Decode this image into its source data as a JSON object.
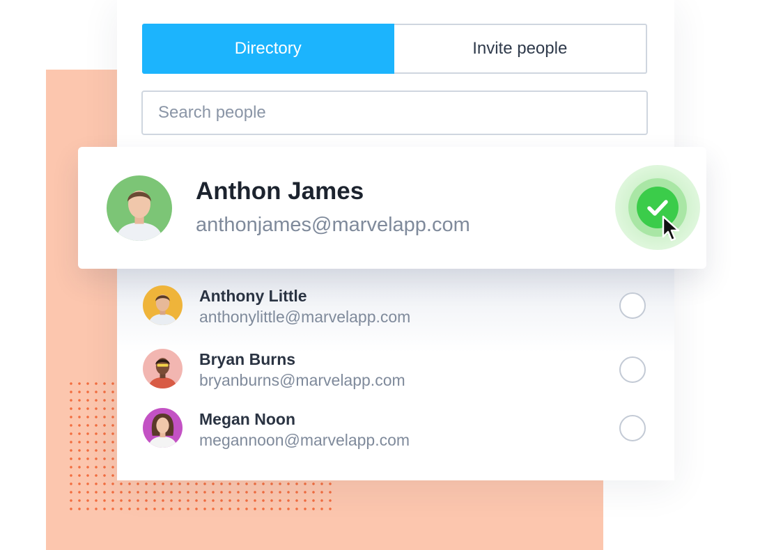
{
  "tabs": {
    "directory_label": "Directory",
    "invite_label": "Invite people",
    "active": "Directory"
  },
  "search": {
    "placeholder": "Search people",
    "value": ""
  },
  "selected_person": {
    "name": "Anthon James",
    "email": "anthonjames@marvelapp.com",
    "selected": true,
    "avatar_bg": "#7cc576",
    "check_color": "#3bcc4a"
  },
  "people": [
    {
      "name": "Anthony Little",
      "email": "anthonylittle@marvelapp.com",
      "selected": false,
      "avatar_bg": "#efb43a"
    },
    {
      "name": "Bryan Burns",
      "email": "bryanburns@marvelapp.com",
      "selected": false,
      "avatar_bg": "#f2b6b1"
    },
    {
      "name": "Megan Noon",
      "email": "megannoon@marvelapp.com",
      "selected": false,
      "avatar_bg": "#c352c4"
    }
  ],
  "colors": {
    "accent": "#1cb4fd",
    "background_block": "#fcc6ae",
    "dot_pattern": "#f26d3f"
  }
}
